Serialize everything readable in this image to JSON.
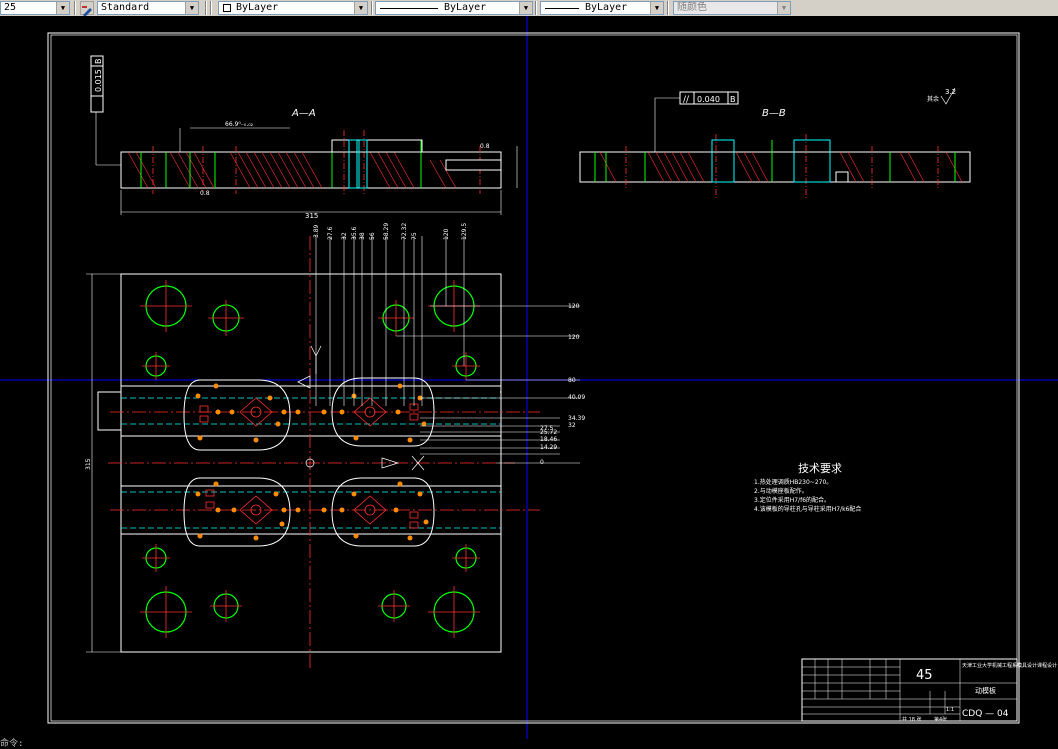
{
  "toolbar": {
    "dimscale": "25",
    "text_style": "Standard",
    "layer": "ByLayer",
    "linetype": "ByLayer",
    "lineweight": "ByLayer",
    "plot_style": "随颜色"
  },
  "drawing": {
    "section_aa": "A—A",
    "section_bb": "B—B",
    "flatness_tol": "0.015",
    "flatness_datum": "B",
    "parallel_tol": "0.040",
    "parallel_datum": "B",
    "roughness_rest": "其余",
    "roughness_value": "3.2",
    "dim_length": "315",
    "dim_height": "315",
    "dim_rows": [
      "3.89",
      "27.6",
      "32",
      "35.6",
      "38",
      "56",
      "58.29",
      "72.32",
      "75",
      "120",
      "129.5"
    ],
    "dim_right": [
      "120",
      "120",
      "80",
      "40.09",
      "34.39",
      "32",
      "27.5",
      "25.72",
      "18.46",
      "14.29",
      "0"
    ],
    "tech_title": "技术要求",
    "tech_items": [
      "1.热处理调质HB230~270。",
      "2.与动模座板配作。",
      "3.定位件采用H7/f6的配合。",
      "4.该模板的导柱孔与导柱采用H7/k6配合"
    ]
  },
  "title_block": {
    "material": "45",
    "school": "天津工业大学机械工程系模具设计课程设计",
    "part_name": "动模板",
    "drawing_no": "CDQ — 04",
    "scale": "1:1",
    "sheet_total": "共 18 张",
    "sheet_no": "第4张"
  },
  "command_line": "命令:"
}
